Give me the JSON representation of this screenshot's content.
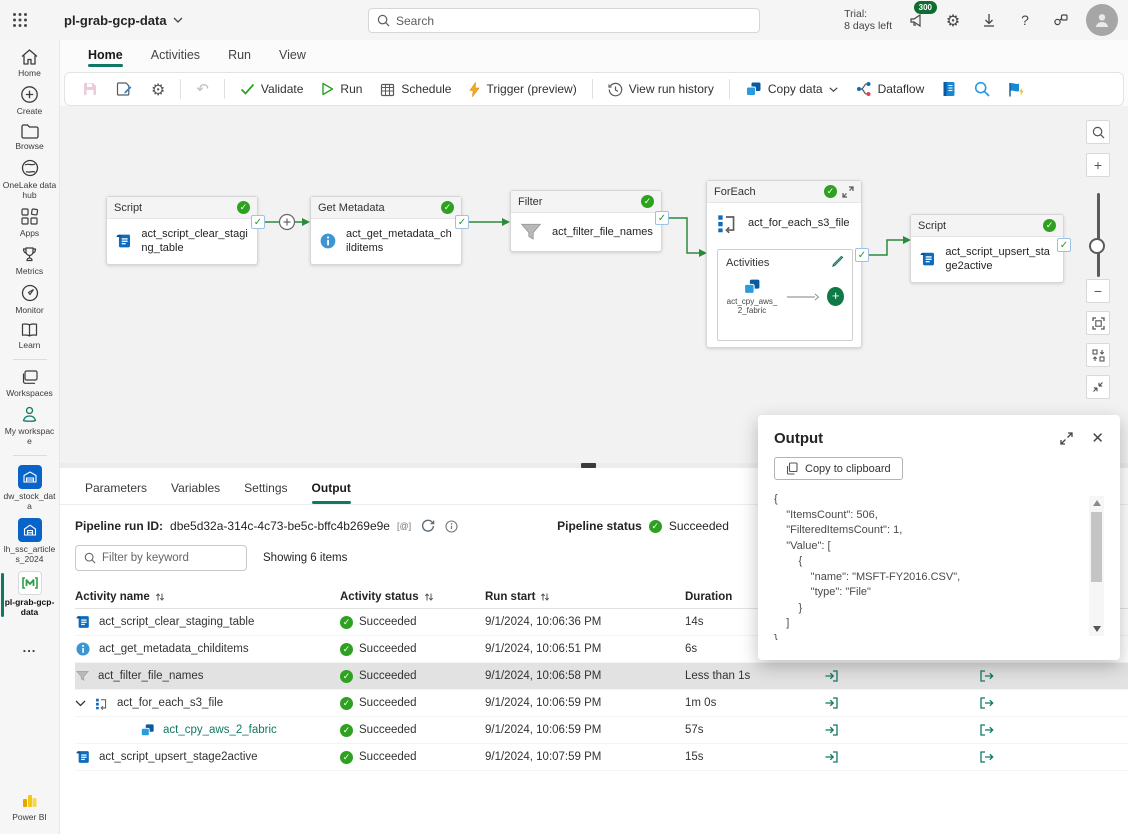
{
  "topbar": {
    "app_title": "pl-grab-gcp-data",
    "search_placeholder": "Search",
    "trial_line1": "Trial:",
    "trial_line2": "8 days left",
    "badge_count": "300",
    "help_label": "?"
  },
  "ribbon_tabs": {
    "items": [
      {
        "label": "Home"
      },
      {
        "label": "Activities"
      },
      {
        "label": "Run"
      },
      {
        "label": "View"
      }
    ]
  },
  "toolbar": {
    "validate_label": "Validate",
    "run_label": "Run",
    "schedule_label": "Schedule",
    "trigger_label": "Trigger (preview)",
    "history_label": "View run history",
    "copy_data_label": "Copy data",
    "dataflow_label": "Dataflow"
  },
  "sidebar": {
    "items": [
      {
        "label": "Home"
      },
      {
        "label": "Create"
      },
      {
        "label": "Browse"
      },
      {
        "label": "OneLake data hub"
      },
      {
        "label": "Apps"
      },
      {
        "label": "Metrics"
      },
      {
        "label": "Monitor"
      },
      {
        "label": "Learn"
      },
      {
        "label": "Workspaces"
      },
      {
        "label": "My workspace"
      },
      {
        "label": "dw_stock_data"
      },
      {
        "label": "lh_ssc_articles_2024"
      },
      {
        "label": "pl-grab-gcp-data"
      },
      {
        "label": "..."
      },
      {
        "label": "Power BI"
      }
    ]
  },
  "canvas": {
    "nodes": [
      {
        "type": "Script",
        "name": "act_script_clear_staging_table"
      },
      {
        "type": "Get Metadata",
        "name": "act_get_metadata_childitems"
      },
      {
        "type": "Filter",
        "name": "act_filter_file_names"
      },
      {
        "type": "ForEach",
        "name": "act_for_each_s3_file",
        "activities_label": "Activities",
        "child_name": "act_cpy_aws_2_fabric"
      },
      {
        "type": "Script",
        "name": "act_script_upsert_stage2active"
      }
    ]
  },
  "bottom": {
    "tabs": [
      {
        "label": "Parameters"
      },
      {
        "label": "Variables"
      },
      {
        "label": "Settings"
      },
      {
        "label": "Output"
      }
    ],
    "run_id_label": "Pipeline run ID:",
    "run_id": "dbe5d32a-314c-4c73-be5c-bffc4b269e9e",
    "status_label": "Pipeline status",
    "status_value": "Succeeded",
    "filter_placeholder": "Filter by keyword",
    "showing_text": "Showing 6 items",
    "columns": [
      {
        "label": "Activity name"
      },
      {
        "label": "Activity status"
      },
      {
        "label": "Run start"
      },
      {
        "label": "Duration"
      }
    ],
    "rows": [
      {
        "name": "act_script_clear_staging_table",
        "status": "Succeeded",
        "start": "9/1/2024, 10:06:36 PM",
        "duration": "14s"
      },
      {
        "name": "act_get_metadata_childitems",
        "status": "Succeeded",
        "start": "9/1/2024, 10:06:51 PM",
        "duration": "6s"
      },
      {
        "name": "act_filter_file_names",
        "status": "Succeeded",
        "start": "9/1/2024, 10:06:58 PM",
        "duration": "Less than 1s"
      },
      {
        "name": "act_for_each_s3_file",
        "status": "Succeeded",
        "start": "9/1/2024, 10:06:59 PM",
        "duration": "1m 0s"
      },
      {
        "name": "act_cpy_aws_2_fabric",
        "status": "Succeeded",
        "start": "9/1/2024, 10:06:59 PM",
        "duration": "57s"
      },
      {
        "name": "act_script_upsert_stage2active",
        "status": "Succeeded",
        "start": "9/1/2024, 10:07:59 PM",
        "duration": "15s"
      }
    ]
  },
  "output_panel": {
    "title": "Output",
    "copy_button": "Copy to clipboard",
    "json": "{\n    \"ItemsCount\": 506,\n    \"FilteredItemsCount\": 1,\n    \"Value\": [\n        {\n            \"name\": \"MSFT-FY2016.CSV\",\n            \"type\": \"File\"\n        }\n    ]\n}"
  },
  "colors": {
    "accent": "#117865",
    "success": "#2ea121",
    "connector": "#2c8a3c",
    "node_blue": "#0f6cbd"
  }
}
